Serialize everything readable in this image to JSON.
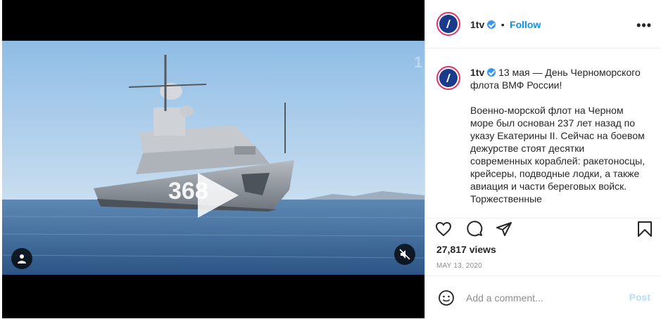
{
  "post": {
    "username": "1tv",
    "follow_separator": "•",
    "follow_label": "Follow",
    "more_label": "•••",
    "caption_paragraphs": [
      "13 мая — День Черноморского флота ВМФ России!",
      "Военно-морской флот на Черном море был основан 237 лет назад по указу Екатерины II. Сейчас на боевом дежурстве стоят десятки современных кораблей: ракетоносцы, крейсеры, подводные лодки, а также авиация и части береговых войск. Торжественные"
    ],
    "views": "27,817 views",
    "date": "MAY 13, 2020"
  },
  "media": {
    "ship_number": "368",
    "play_icon": "play-icon",
    "user_icon": "user-icon",
    "mute_icon": "muted-speaker-icon"
  },
  "actions": {
    "like_icon": "heart-icon",
    "comment_icon": "comment-icon",
    "share_icon": "paper-plane-icon",
    "save_icon": "bookmark-icon"
  },
  "comment_box": {
    "emoji_icon": "emoji-icon",
    "placeholder": "Add a comment...",
    "post_label": "Post"
  },
  "colors": {
    "accent": "#0095f6",
    "post_disabled": "#b2dffc",
    "verified": "#3897f0",
    "sky": "#9ec6ea",
    "sea": "#3f6a98"
  }
}
